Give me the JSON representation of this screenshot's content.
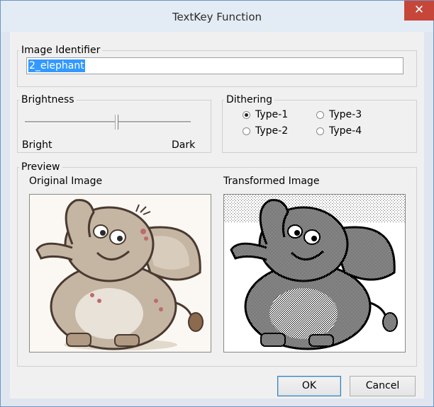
{
  "window": {
    "title": "TextKey Function",
    "close_glyph": "✕"
  },
  "identifier": {
    "legend": "Image Identifier",
    "value": "2_elephant"
  },
  "brightness": {
    "legend": "Brightness",
    "min_label": "Bright",
    "max_label": "Dark",
    "level": 0.55
  },
  "dithering": {
    "legend": "Dithering",
    "options": [
      "Type-1",
      "Type-3",
      "Type-2",
      "Type-4"
    ],
    "selected": "Type-1"
  },
  "preview": {
    "legend": "Preview",
    "original_label": "Original Image",
    "transformed_label": "Transformed Image"
  },
  "buttons": {
    "ok": "OK",
    "cancel": "Cancel"
  },
  "colors": {
    "title_bar": "#e3ebf4",
    "close_button": "#c7463a",
    "selection": "#3399ff",
    "elephant_body": "#c4b6a3",
    "elephant_outline": "#4a3a30"
  }
}
